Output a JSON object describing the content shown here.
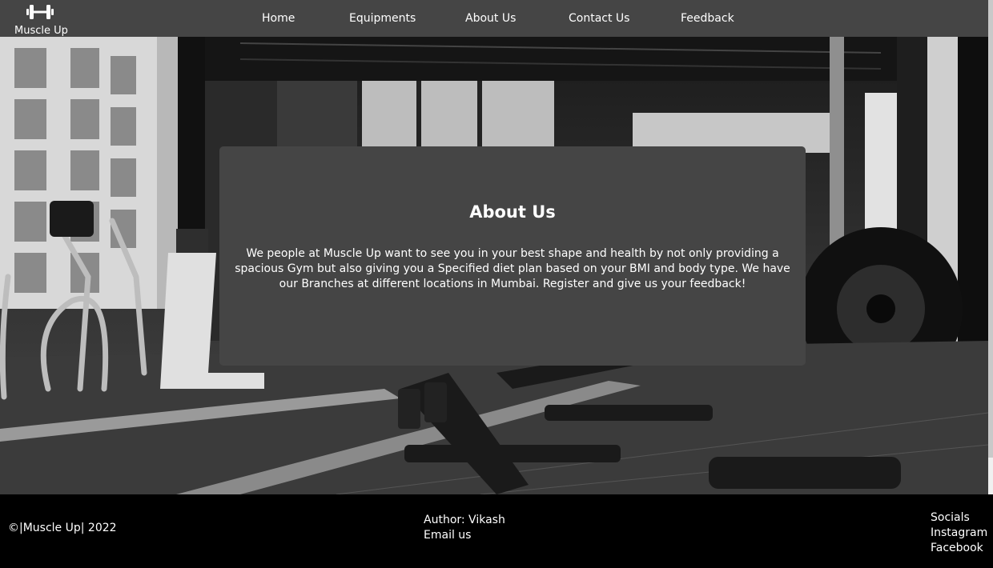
{
  "nav": {
    "brand_label": "Muscle Up",
    "links": [
      "Home",
      "Equipments",
      "About Us",
      "Contact Us",
      "Feedback"
    ]
  },
  "about": {
    "title": "About Us",
    "text": "We people at Muscle Up want to see you in your best shape and health by not only providing a spacious Gym but also giving you a Specified diet plan based on your BMI and body type. We have our Branches at different locations in Mumbai. Register and give us your feedback!"
  },
  "footer": {
    "copyright": "©|Muscle Up| 2022",
    "author": "Author: Vikash",
    "email": "Email us",
    "socials_heading": "Socials",
    "socials": [
      "Instagram",
      "Facebook"
    ]
  },
  "colors": {
    "navbar_bg": "#454545",
    "card_bg": "#454545",
    "footer_bg": "#000000"
  },
  "icons": {
    "brand": "dumbbell-icon"
  }
}
